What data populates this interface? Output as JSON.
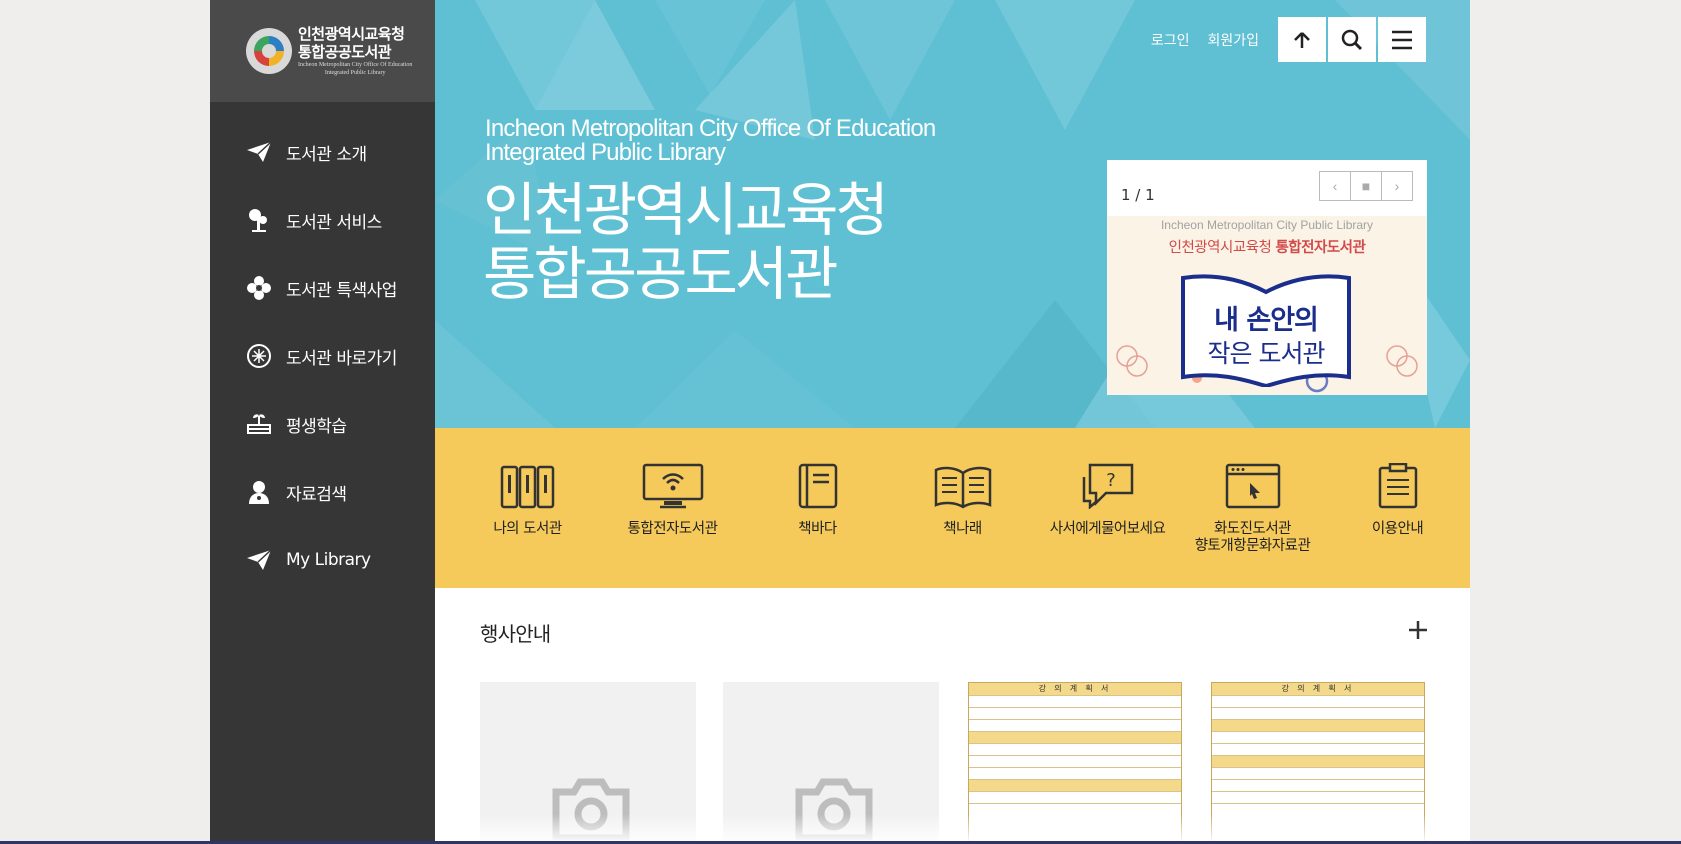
{
  "logo": {
    "line1": "인천광역시교육청",
    "line2": "통합공공도서관",
    "line3": "Incheon Metropolitan City Office Of Education",
    "line4": "Integrated Public Library"
  },
  "sidebar": {
    "items": [
      {
        "label": "도서관 소개",
        "icon": "paper-plane-icon"
      },
      {
        "label": "도서관 서비스",
        "icon": "tree-icon"
      },
      {
        "label": "도서관 특색사업",
        "icon": "flower-icon"
      },
      {
        "label": "도서관 바로가기",
        "icon": "compass-icon"
      },
      {
        "label": "평생학습",
        "icon": "book-sprout-icon"
      },
      {
        "label": "자료검색",
        "icon": "person-search-icon"
      },
      {
        "label": "My Library",
        "icon": "paper-plane-icon"
      }
    ]
  },
  "header": {
    "login": "로그인",
    "signup": "회원가입",
    "buttons": [
      "up-arrow-icon",
      "search-icon",
      "menu-icon"
    ]
  },
  "hero": {
    "en_line1": "Incheon Metropolitan City Office Of Education",
    "en_line2": "Integrated Public Library",
    "ko_line1": "인천광역시교육청",
    "ko_line2": "통합공공도서관"
  },
  "slider": {
    "counter": "1 / 1",
    "prev": "‹",
    "stop": "■",
    "next": "›",
    "slide": {
      "en": "Incheon Metropolitan City Public Library",
      "ko_prefix": "인천광역시교육청 ",
      "ko_bold": "통합전자도서관",
      "book_line1": "내 손안의",
      "book_line2": "작은 도서관"
    }
  },
  "quick_links": [
    {
      "label": "나의 도서관",
      "icon": "books-icon"
    },
    {
      "label": "통합전자도서관",
      "icon": "monitor-wifi-icon"
    },
    {
      "label": "책바다",
      "icon": "book-icon"
    },
    {
      "label": "책나래",
      "icon": "open-book-icon"
    },
    {
      "label": "사서에게물어보세요",
      "icon": "question-bubble-icon"
    },
    {
      "label": "화도진도서관\n향토개항문화자료관",
      "icon": "browser-window-icon"
    },
    {
      "label": "이용안내",
      "icon": "clipboard-icon"
    }
  ],
  "events": {
    "title": "행사안내",
    "more": "plus-icon",
    "doc_header": "강 의 계 획 서"
  },
  "colors": {
    "sidebar_bg": "#363636",
    "hero_bg": "#5fbfd3",
    "quick_bg": "#f6ca5a",
    "accent_blue": "#1c2e8c"
  }
}
